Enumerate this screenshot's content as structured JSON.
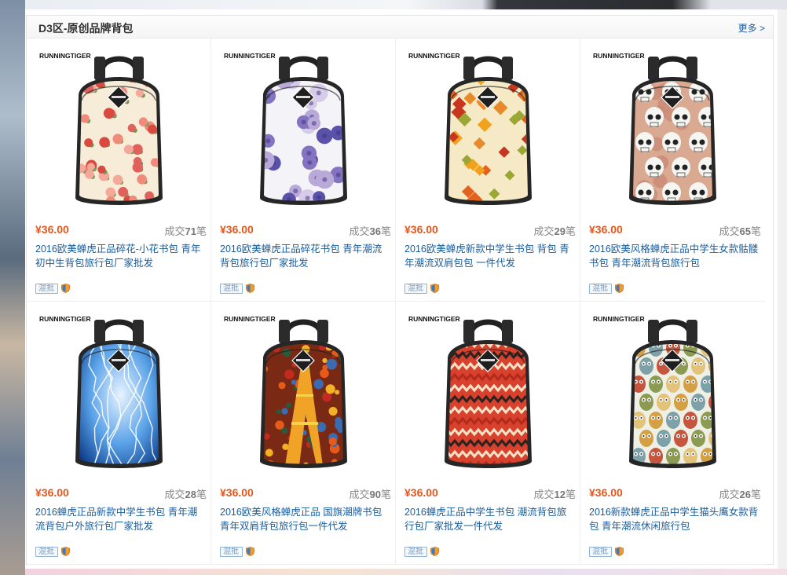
{
  "section": {
    "title": "D3区-原创品牌背包",
    "more_label": "更多 >"
  },
  "products": [
    {
      "brand": "RUNNINGTIGER",
      "price": "¥36.00",
      "sold_prefix": "成交",
      "sold_count": "71",
      "sold_suffix": "笔",
      "name": "2016欧美蝉虎正品碎花-小花书包 青年初中生背包旅行包厂家批发",
      "tag": "混批",
      "pattern": "floral-pink"
    },
    {
      "brand": "RUNNINGTIGER",
      "price": "¥36.00",
      "sold_prefix": "成交",
      "sold_count": "36",
      "sold_suffix": "笔",
      "name": "2016欧美蝉虎正品碎花书包 青年潮流背包旅行包厂家批发",
      "tag": "混批",
      "pattern": "floral-purple"
    },
    {
      "brand": "RUNNINGTIGER",
      "price": "¥36.00",
      "sold_prefix": "成交",
      "sold_count": "29",
      "sold_suffix": "笔",
      "name": "2016欧美蝉虎新款中学生书包 背包 青年潮流双肩包包 一件代发",
      "tag": "混批",
      "pattern": "autumn-leaves"
    },
    {
      "brand": "RUNNINGTIGER",
      "price": "¥36.00",
      "sold_prefix": "成交",
      "sold_count": "65",
      "sold_suffix": "笔",
      "name": "2016欧美风格蝉虎正品中学生女款骷髅书包 青年潮流背包旅行包",
      "tag": "混批",
      "pattern": "skulls"
    },
    {
      "brand": "RUNNINGTIGER",
      "price": "¥36.00",
      "sold_prefix": "成交",
      "sold_count": "28",
      "sold_suffix": "笔",
      "name": "2016蝉虎正品新款中学生书包 青年潮流背包户外旅行包厂家批发",
      "tag": "混批",
      "pattern": "lightning"
    },
    {
      "brand": "RUNNINGTIGER",
      "price": "¥36.00",
      "sold_prefix": "成交",
      "sold_count": "90",
      "sold_suffix": "笔",
      "name": "2016欧美风格蝉虎正品 国旗潮牌书包 青年双肩背包旅行包一件代发",
      "tag": "混批",
      "pattern": "eiffel"
    },
    {
      "brand": "RUNNINGTIGER",
      "price": "¥36.00",
      "sold_prefix": "成交",
      "sold_count": "12",
      "sold_suffix": "笔",
      "name": "2016蝉虎正品中学生书包 潮流背包旅行包厂家批发一件代发",
      "tag": "混批",
      "pattern": "tribal"
    },
    {
      "brand": "RUNNINGTIGER",
      "price": "¥36.00",
      "sold_prefix": "成交",
      "sold_count": "26",
      "sold_suffix": "笔",
      "name": "2016新款蝉虎正品中学生猫头鹰女款背包 青年潮流休闲旅行包",
      "tag": "混批",
      "pattern": "owls"
    }
  ]
}
